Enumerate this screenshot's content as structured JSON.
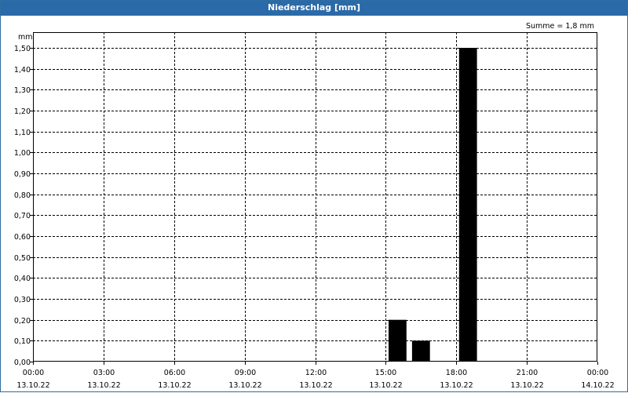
{
  "window": {
    "title": "Niederschlag [mm]"
  },
  "chart_data": {
    "type": "bar",
    "title": "Niederschlag [mm]",
    "ylabel": "mm",
    "xlabel": "",
    "ylim": [
      0,
      1.5
    ],
    "y_ticks": [
      "0,00",
      "0,10",
      "0,20",
      "0,30",
      "0,40",
      "0,50",
      "0,60",
      "0,70",
      "0,80",
      "0,90",
      "1,00",
      "1,10",
      "1,20",
      "1,30",
      "1,40",
      "1,50"
    ],
    "x_ticks": [
      {
        "time": "00:00",
        "date": "13.10.22"
      },
      {
        "time": "03:00",
        "date": "13.10.22"
      },
      {
        "time": "06:00",
        "date": "13.10.22"
      },
      {
        "time": "09:00",
        "date": "13.10.22"
      },
      {
        "time": "12:00",
        "date": "13.10.22"
      },
      {
        "time": "15:00",
        "date": "13.10.22"
      },
      {
        "time": "18:00",
        "date": "13.10.22"
      },
      {
        "time": "21:00",
        "date": "13.10.22"
      },
      {
        "time": "00:00",
        "date": "14.10.22"
      }
    ],
    "x_range_hours": [
      0,
      24
    ],
    "bars": [
      {
        "hour": 15.5,
        "value": 0.2
      },
      {
        "hour": 16.5,
        "value": 0.1
      },
      {
        "hour": 18.5,
        "value": 1.5
      }
    ],
    "annotation": "Summe = 1,8 mm",
    "grid": true,
    "bar_color": "#000000"
  }
}
